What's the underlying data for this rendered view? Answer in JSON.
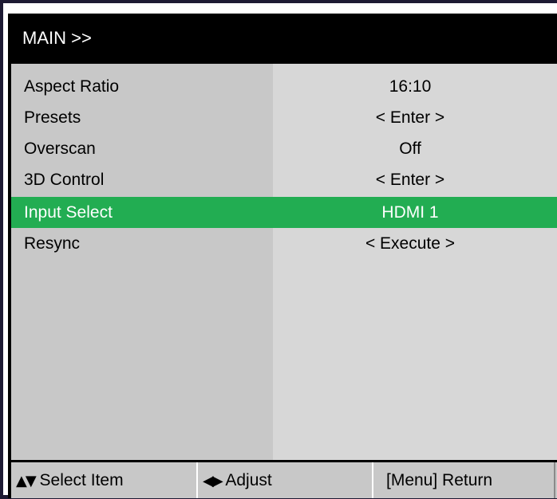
{
  "title": "MAIN >>",
  "menu": {
    "items": [
      {
        "label": "Aspect Ratio",
        "value": "16:10",
        "selected": false
      },
      {
        "label": "Presets",
        "value": "< Enter >",
        "selected": false
      },
      {
        "label": "Overscan",
        "value": "Off",
        "selected": false
      },
      {
        "label": "3D Control",
        "value": "< Enter >",
        "selected": false
      },
      {
        "label": "Input Select",
        "value": "HDMI 1",
        "selected": true
      },
      {
        "label": "Resync",
        "value": "< Execute >",
        "selected": false
      }
    ]
  },
  "status_bar": {
    "select_icon": "up-down-arrows-icon",
    "select_label": "Select Item",
    "adjust_icon": "left-right-arrows-icon",
    "adjust_label": "Adjust",
    "return_label": "[Menu] Return"
  },
  "colors": {
    "selection": "#22ad52",
    "title_background": "#000000",
    "label_column": "#c8c8c8",
    "value_column": "#d7d7d7"
  }
}
